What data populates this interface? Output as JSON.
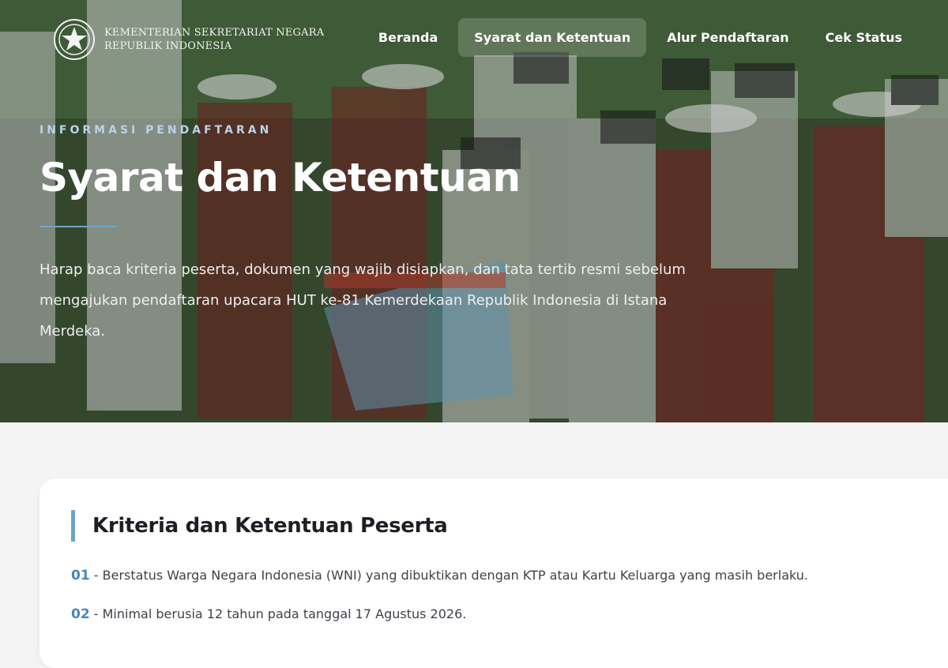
{
  "brand": {
    "line1": "KEMENTERIAN SEKRETARIAT NEGARA",
    "line2": "REPUBLIK INDONESIA"
  },
  "nav": {
    "items": [
      {
        "label": "Beranda",
        "active": false
      },
      {
        "label": "Syarat dan Ketentuan",
        "active": true
      },
      {
        "label": "Alur Pendaftaran",
        "active": false
      },
      {
        "label": "Cek Status",
        "active": false
      }
    ]
  },
  "hero": {
    "eyebrow": "INFORMASI PENDAFTARAN",
    "title": "Syarat dan Ketentuan",
    "description": "Harap baca kriteria peserta, dokumen yang wajib disiapkan, dan tata tertib resmi sebelum mengajukan pendaftaran upacara HUT ke-81 Kemerdekaan Republik Indonesia di Istana Merdeka."
  },
  "criteria": {
    "title": "Kriteria dan Ketentuan Peserta",
    "items": [
      {
        "num": "01",
        "text": "Berstatus Warga Negara Indonesia (WNI) yang dibuktikan dengan KTP atau Kartu Keluarga yang masih berlaku."
      },
      {
        "num": "02",
        "text": "Minimal berusia 12 tahun pada tanggal 17 Agustus 2026."
      }
    ]
  },
  "colors": {
    "accent": "#6ea4cc",
    "number": "#4a87b8",
    "heading": "#1c1f24"
  }
}
